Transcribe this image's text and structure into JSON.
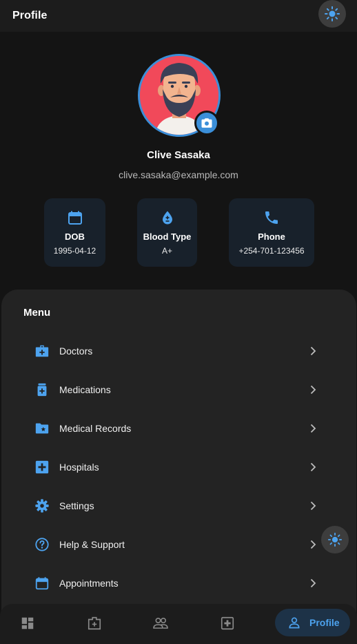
{
  "appbar": {
    "title": "Profile",
    "theme_icon": "sun-icon"
  },
  "profile": {
    "name": "Clive Sasaka",
    "email": "clive.sasaka@example.com",
    "avatar_icon": "bearded-man-avatar",
    "camera_icon": "camera-icon"
  },
  "info_cards": [
    {
      "icon": "calendar-icon",
      "label": "DOB",
      "value": "1995-04-12"
    },
    {
      "icon": "blood-drop-icon",
      "label": "Blood Type",
      "value": "A+"
    },
    {
      "icon": "phone-icon",
      "label": "Phone",
      "value": "+254-701-123456"
    }
  ],
  "menu": {
    "title": "Menu",
    "items": [
      {
        "label": "Doctors",
        "icon": "medical-bag-icon"
      },
      {
        "label": "Medications",
        "icon": "medication-bottle-icon"
      },
      {
        "label": "Medical Records",
        "icon": "folder-star-icon"
      },
      {
        "label": "Hospitals",
        "icon": "hospital-cross-icon"
      },
      {
        "label": "Settings",
        "icon": "gear-icon"
      },
      {
        "label": "Help & Support",
        "icon": "help-circle-icon"
      },
      {
        "label": "Appointments",
        "icon": "calendar-icon"
      }
    ]
  },
  "bottom_nav": {
    "items": [
      {
        "icon": "dashboard-icon"
      },
      {
        "icon": "medical-bag-icon"
      },
      {
        "icon": "people-icon"
      },
      {
        "icon": "hospital-cross-icon"
      }
    ],
    "active": {
      "label": "Profile",
      "icon": "person-icon"
    }
  },
  "colors": {
    "accent": "#3b8fd9",
    "background": "#141414",
    "panel": "#232323",
    "card": "#18212b"
  }
}
